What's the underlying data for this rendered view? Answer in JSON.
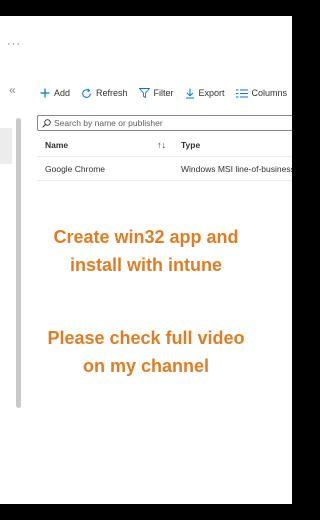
{
  "header": {
    "overflow_glyph": "···"
  },
  "nav": {
    "collapse_glyph": "«"
  },
  "toolbar": {
    "items": [
      {
        "label": "Add",
        "icon": "plus-icon"
      },
      {
        "label": "Refresh",
        "icon": "refresh-icon"
      },
      {
        "label": "Filter",
        "icon": "filter-icon"
      },
      {
        "label": "Export",
        "icon": "download-icon"
      },
      {
        "label": "Columns",
        "icon": "columns-icon"
      }
    ]
  },
  "search": {
    "placeholder": "Search by name or publisher"
  },
  "table": {
    "columns": [
      "Name",
      "Type"
    ],
    "sort_glyph": "↑↓",
    "rows": [
      {
        "name": "Google Chrome",
        "type": "Windows MSI line-of-business app"
      }
    ]
  },
  "overlay": {
    "line1": "Create win32 app and",
    "line2": "install with intune",
    "line3": "Please check full video",
    "line4": "on my channel",
    "color": "#e07d24"
  },
  "colors": {
    "accent": "#0078d4"
  }
}
